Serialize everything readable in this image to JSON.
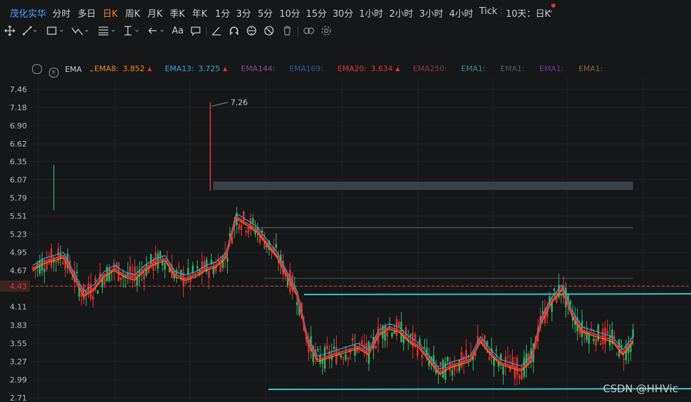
{
  "stock_name": "茂化实华",
  "timeframes": [
    "分时",
    "多日",
    "日K",
    "周K",
    "月K",
    "季K",
    "年K",
    "1分",
    "3分",
    "5分",
    "10分",
    "15分",
    "30分",
    "1小时",
    "2小时",
    "3小时",
    "4小时",
    "Tick",
    "10天：日K"
  ],
  "active_timeframe": "日K",
  "indicator": {
    "name": "EMA",
    "lines": [
      {
        "label": "EMA8:",
        "value": "3.852",
        "arrow": "▲",
        "color": "#f0842c"
      },
      {
        "label": "EMA13:",
        "value": "3.725",
        "arrow": "▲",
        "color": "#2fa8e0"
      },
      {
        "label": "EMA144:",
        "value": "",
        "arrow": "",
        "color": "#8a4d8a"
      },
      {
        "label": "EMA169:",
        "value": "",
        "arrow": "",
        "color": "#2a5a9a"
      },
      {
        "label": "EMA20:",
        "value": "3.634",
        "arrow": "▲",
        "color": "#e8312f"
      },
      {
        "label": "EMA250:",
        "value": "",
        "arrow": "",
        "color": "#8a3a3a"
      },
      {
        "label": "EMA1:",
        "value": "",
        "arrow": "",
        "color": "#2f8f8f"
      },
      {
        "label": "EMA1:",
        "value": "",
        "arrow": "",
        "color": "#555a60"
      },
      {
        "label": "EMA1:",
        "value": "",
        "arrow": "",
        "color": "#6a3e9a"
      },
      {
        "label": "EMA1:",
        "value": "",
        "arrow": "",
        "color": "#8a6a30"
      }
    ]
  },
  "chart_data": {
    "type": "candlestick",
    "y_ticks": [
      "7.46",
      "7.18",
      "6.90",
      "6.62",
      "6.35",
      "6.07",
      "5.79",
      "5.51",
      "5.23",
      "4.95",
      "4.67",
      "4.43",
      "4.11",
      "3.83",
      "3.55",
      "3.27",
      "2.99",
      "2.71"
    ],
    "ylim": [
      2.71,
      7.46
    ],
    "current_price": "4.43",
    "high_marker": "7.26",
    "ema20_approx": [
      4.7,
      4.8,
      4.85,
      4.9,
      4.6,
      4.3,
      4.4,
      4.6,
      4.7,
      4.6,
      4.55,
      4.7,
      4.8,
      4.85,
      4.6,
      4.55,
      4.6,
      4.7,
      4.75,
      4.9,
      5.5,
      5.4,
      5.3,
      5.1,
      4.9,
      4.6,
      4.3,
      3.6,
      3.3,
      3.35,
      3.4,
      3.45,
      3.5,
      3.4,
      3.7,
      3.8,
      3.75,
      3.6,
      3.5,
      3.3,
      3.1,
      3.2,
      3.25,
      3.3,
      3.6,
      3.4,
      3.25,
      3.2,
      3.15,
      3.3,
      3.9,
      4.2,
      4.4,
      4.0,
      3.75,
      3.7,
      3.65,
      3.6,
      3.4,
      3.6
    ],
    "resistance_lines": [
      4.3,
      5.33,
      4.55
    ],
    "support_line": 2.85,
    "watermark": "CSDN @HHVic"
  }
}
